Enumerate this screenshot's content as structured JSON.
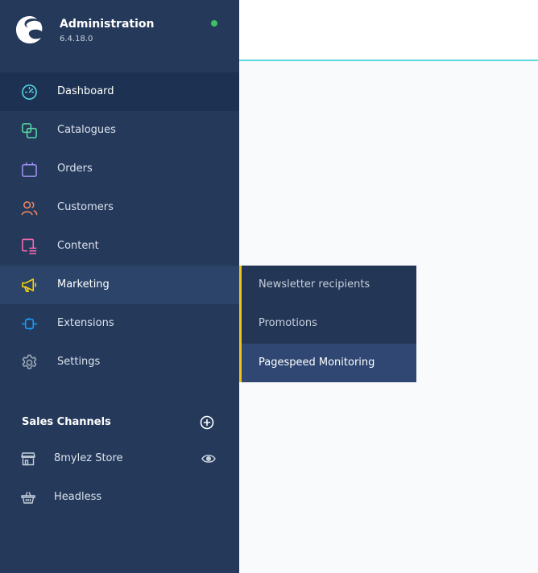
{
  "brand": {
    "title": "Administration",
    "version": "6.4.18.0",
    "status_color": "#3cc261"
  },
  "nav": {
    "items": [
      {
        "label": "Dashboard",
        "icon": "dashboard-gauge-icon",
        "color": "#57d9e4"
      },
      {
        "label": "Catalogues",
        "icon": "catalogue-icon",
        "color": "#57d9a3"
      },
      {
        "label": "Orders",
        "icon": "orders-bag-icon",
        "color": "#a092f0"
      },
      {
        "label": "Customers",
        "icon": "customers-icon",
        "color": "#f88962"
      },
      {
        "label": "Content",
        "icon": "content-icon",
        "color": "#ff68b4"
      },
      {
        "label": "Marketing",
        "icon": "marketing-megaphone-icon",
        "color": "#ffd700"
      },
      {
        "label": "Extensions",
        "icon": "extensions-plug-icon",
        "color": "#189eff"
      },
      {
        "label": "Settings",
        "icon": "settings-gear-icon",
        "color": "#9aa8b5"
      }
    ]
  },
  "sales_channels": {
    "header": "Sales Channels",
    "items": [
      {
        "label": "8mylez Store",
        "icon": "storefront-icon"
      },
      {
        "label": "Headless",
        "icon": "basket-icon"
      }
    ]
  },
  "flyout": {
    "items": [
      {
        "label": "Newsletter recipients"
      },
      {
        "label": "Promotions"
      },
      {
        "label": "Pagespeed Monitoring"
      }
    ]
  }
}
